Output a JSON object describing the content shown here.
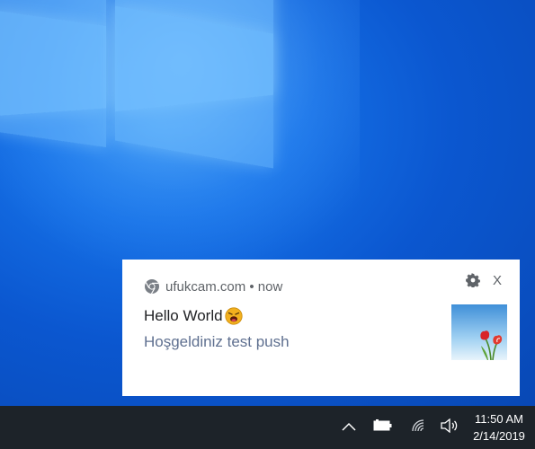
{
  "notification": {
    "source": "ufukcam.com • now",
    "title": "Hello World",
    "body": "Hoşgeldiniz test push",
    "close_label": "X",
    "icons": {
      "browser": "chrome-icon",
      "settings": "gear-icon",
      "emoji": "angry-face-emoji-icon",
      "image": "tulip-image"
    }
  },
  "taskbar": {
    "tray": [
      "chevron-up-icon",
      "battery-icon",
      "network-icon",
      "volume-icon"
    ],
    "time": "11:50 AM",
    "date": "2/14/2019"
  },
  "colors": {
    "desktop_blue": "#0b57d0",
    "taskbar": "#1d2329",
    "notification_bg": "#ffffff",
    "body_text": "#5f7090"
  }
}
